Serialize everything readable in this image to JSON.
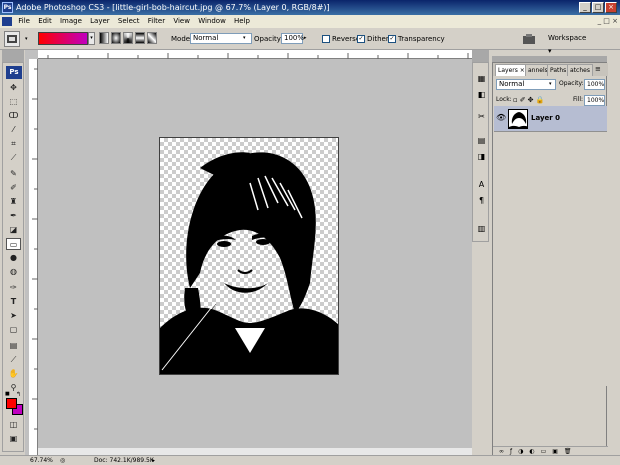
{
  "titlebar": {
    "app_icon": "Ps",
    "title": "Adobe Photoshop CS3 - [little-girl-bob-haircut.jpg @ 67.7% (Layer 0, RGB/8#)]",
    "minimize": "_",
    "maximize": "□",
    "close": "×"
  },
  "menu": [
    "File",
    "Edit",
    "Image",
    "Layer",
    "Select",
    "Filter",
    "View",
    "Window",
    "Help"
  ],
  "options": {
    "mode_label": "Mode:",
    "mode_value": "Normal",
    "opacity_label": "Opacity:",
    "opacity_value": "100%",
    "reverse_label": "Reverse",
    "dither_label": "Dither",
    "transparency_label": "Transparency",
    "workspace_label": "Workspace",
    "gradient_colors": [
      "#ff0000",
      "#c000c0"
    ]
  },
  "toolbox": {
    "logo": "Ps",
    "foreground_color": "#ff0000",
    "background_color": "#c000c0",
    "tools": [
      "move-tool-icon",
      "marquee-tool-icon",
      "lasso-tool-icon",
      "magic-wand-icon",
      "crop-tool-icon",
      "eyedropper-icon",
      "healing-brush-icon",
      "brush-tool-icon",
      "clone-stamp-icon",
      "history-brush-icon",
      "eraser-icon",
      "gradient-tool-icon",
      "blur-tool-icon",
      "dodge-tool-icon",
      "pen-tool-icon",
      "type-tool-icon",
      "path-selection-icon",
      "shape-tool-icon",
      "notes-tool-icon",
      "eyedropper2-icon",
      "hand-tool-icon",
      "zoom-tool-icon"
    ]
  },
  "layers_panel": {
    "tabs": [
      "Layers",
      "annels",
      "Paths",
      "atches"
    ],
    "blend_mode": "Normal",
    "opacity_label": "Opacity:",
    "opacity_value": "100%",
    "lock_label": "Lock:",
    "fill_label": "Fill:",
    "fill_value": "100%",
    "layer_name": "Layer 0"
  },
  "status": {
    "zoom": "67.74%",
    "doc": "Doc: 742.1K/989.5K"
  }
}
